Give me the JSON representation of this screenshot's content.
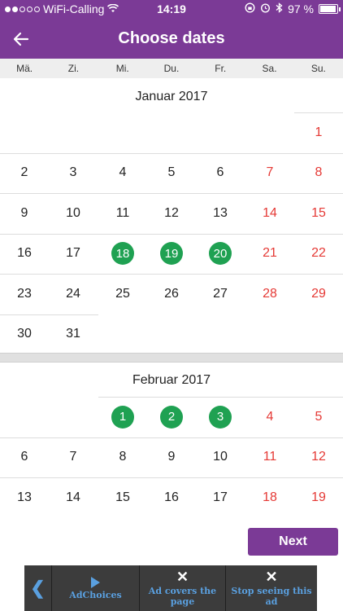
{
  "status_bar": {
    "carrier": "WiFi-Calling",
    "time": "14:19",
    "battery": "97 %",
    "battery_level": 0.97
  },
  "app_bar": {
    "title": "Choose dates",
    "back_icon": "arrow-left-icon"
  },
  "weekdays": [
    "Mä.",
    "Zi.",
    "Mi.",
    "Du.",
    "Fr.",
    "Sa.",
    "Su."
  ],
  "months": [
    {
      "title": "Januar 2017",
      "weeks": [
        [
          "",
          "",
          "",
          "",
          "",
          "",
          "1"
        ],
        [
          "2",
          "3",
          "4",
          "5",
          "6",
          "7",
          "8"
        ],
        [
          "9",
          "10",
          "11",
          "12",
          "13",
          "14",
          "15"
        ],
        [
          "16",
          "17",
          "18",
          "19",
          "20",
          "21",
          "22"
        ],
        [
          "23",
          "24",
          "25",
          "26",
          "27",
          "28",
          "29"
        ],
        [
          "30",
          "31",
          "",
          "",
          "",
          "",
          ""
        ]
      ],
      "selected": [
        "18",
        "19",
        "20"
      ]
    },
    {
      "title": "Februar 2017",
      "weeks": [
        [
          "",
          "",
          "1",
          "2",
          "3",
          "4",
          "5"
        ],
        [
          "6",
          "7",
          "8",
          "9",
          "10",
          "11",
          "12"
        ],
        [
          "13",
          "14",
          "15",
          "16",
          "17",
          "18",
          "19"
        ]
      ],
      "selected": [
        "1",
        "2",
        "3"
      ]
    }
  ],
  "next_button": "Next",
  "ad": {
    "adchoices": "AdChoices",
    "covers_page": "Ad covers the page",
    "stop_seeing": "Stop seeing this ad"
  },
  "colors": {
    "brand": "#7b3a96",
    "selected": "#1fa152",
    "weekend": "#e53935"
  }
}
